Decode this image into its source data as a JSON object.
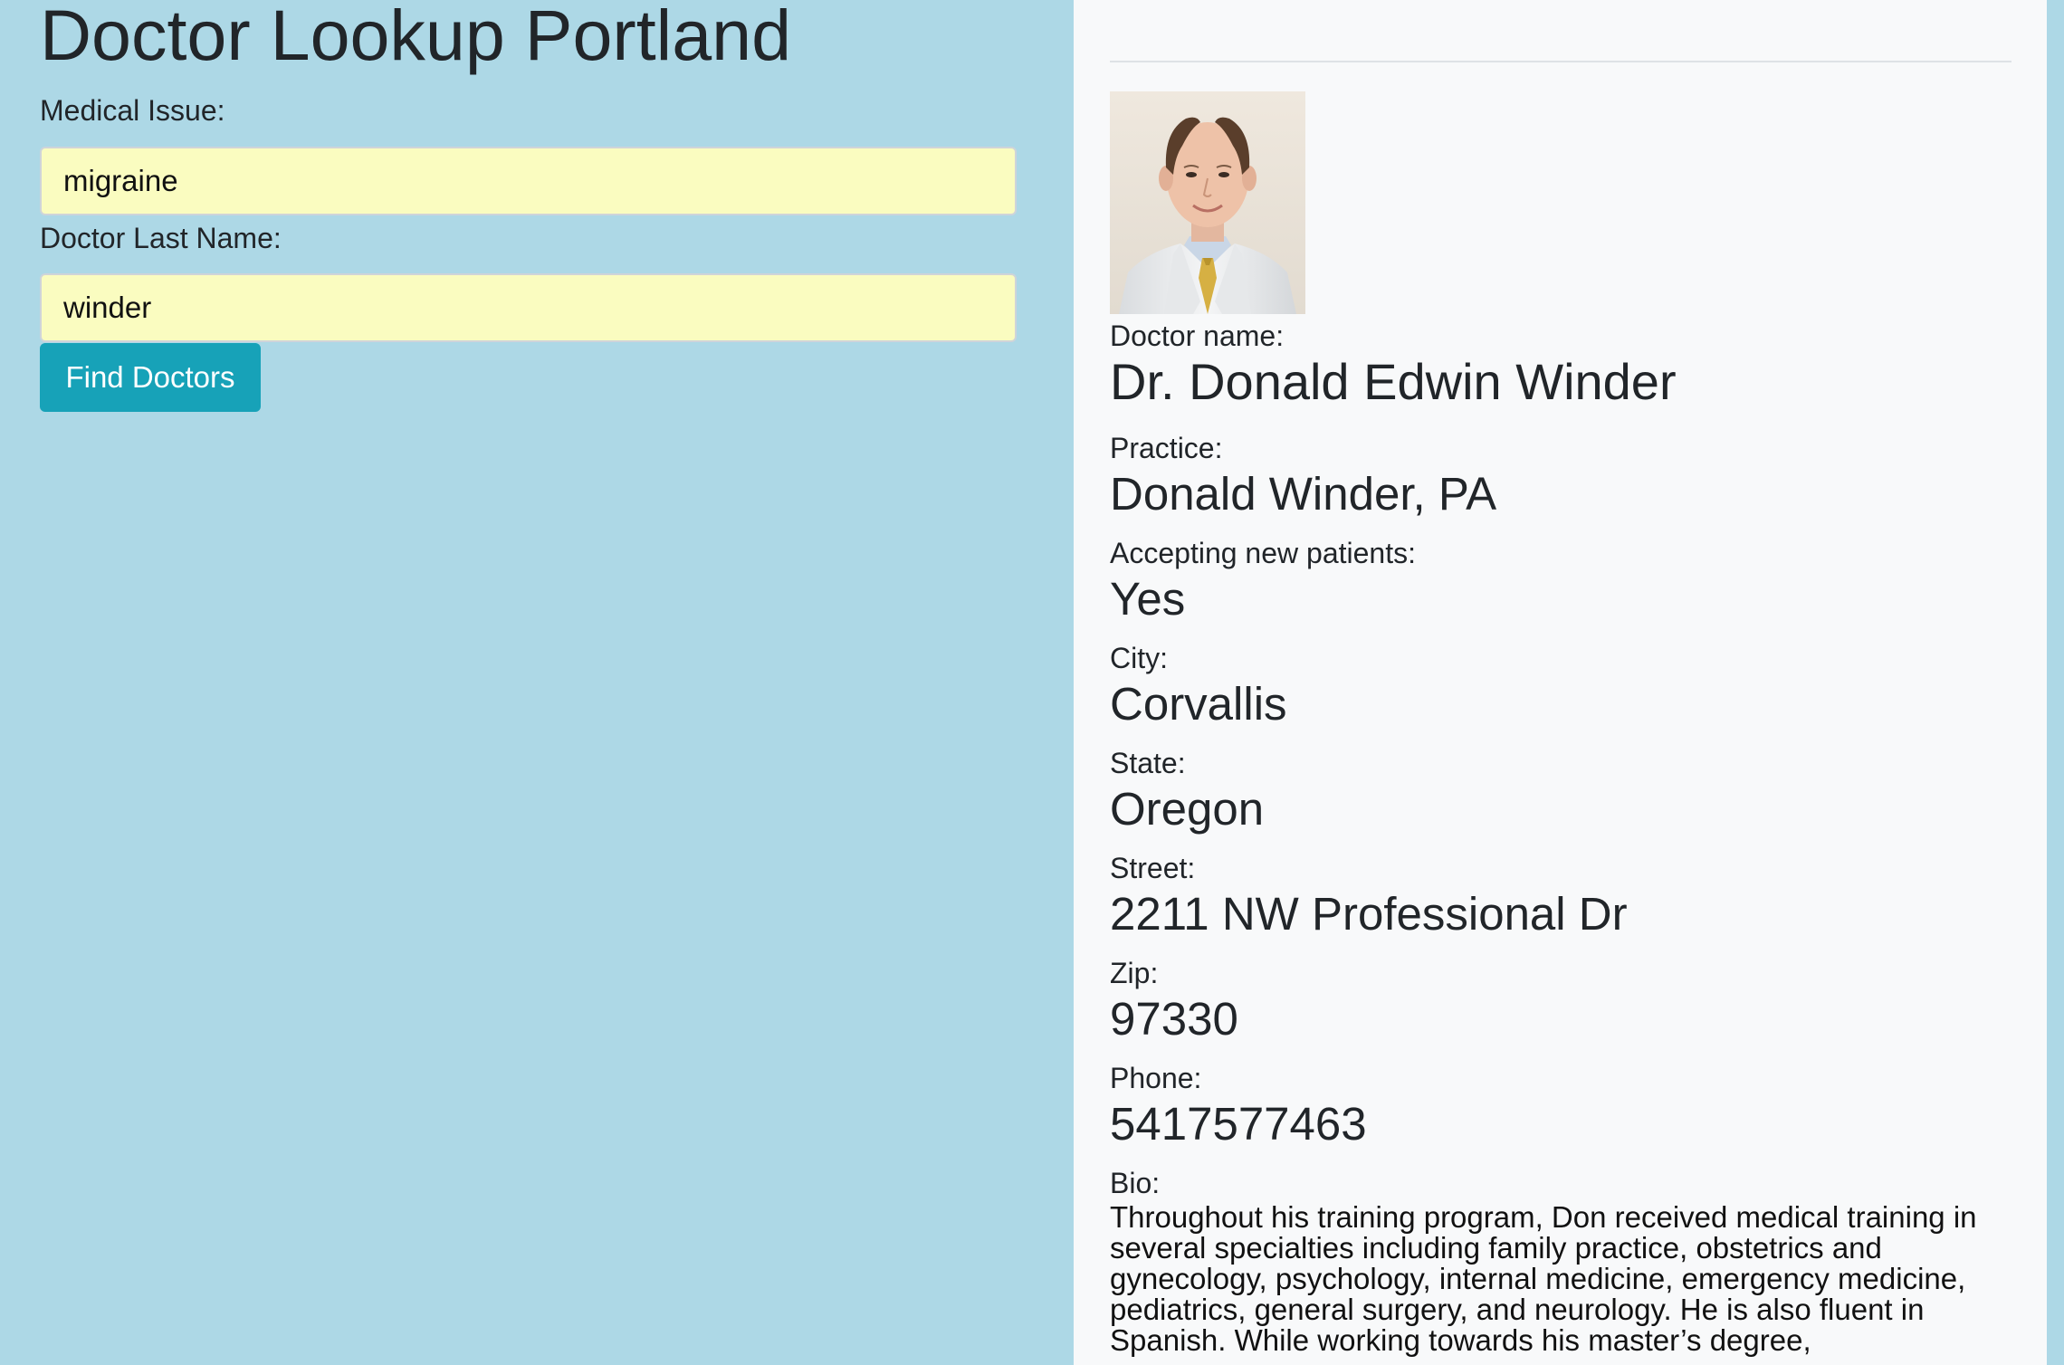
{
  "app": {
    "title": "Doctor Lookup Portland"
  },
  "search": {
    "issue_label": "Medical Issue:",
    "issue_value": "migraine",
    "lastname_label": "Doctor Last Name:",
    "lastname_value": "winder",
    "button_label": "Find Doctors"
  },
  "doctor": {
    "name_label": "Doctor name:",
    "name": "Dr. Donald Edwin Winder",
    "practice_label": "Practice:",
    "practice": "Donald Winder, PA",
    "accepting_label": "Accepting new patients:",
    "accepting": "Yes",
    "city_label": "City:",
    "city": "Corvallis",
    "state_label": "State:",
    "state": "Oregon",
    "street_label": "Street:",
    "street": "2211 NW Professional Dr",
    "zip_label": "Zip:",
    "zip": "97330",
    "phone_label": "Phone:",
    "phone": "5417577463",
    "bio_label": "Bio:",
    "bio": "Throughout his training program, Don received medical training in several specialties including family practice, obstetrics and gynecology, psychology, internal medicine, emergency medicine, pediatrics, general surgery, and neurology. He is also fluent in Spanish. While working towards his master’s degree,"
  },
  "colors": {
    "left_background": "#add8e6",
    "right_background": "#f8f9fa",
    "input_background": "#fafcc0",
    "button_background": "#17a2b8",
    "button_text": "#ffffff",
    "text": "#212529"
  },
  "icons": {
    "doctor_photo": "doctor-portrait-photo"
  }
}
